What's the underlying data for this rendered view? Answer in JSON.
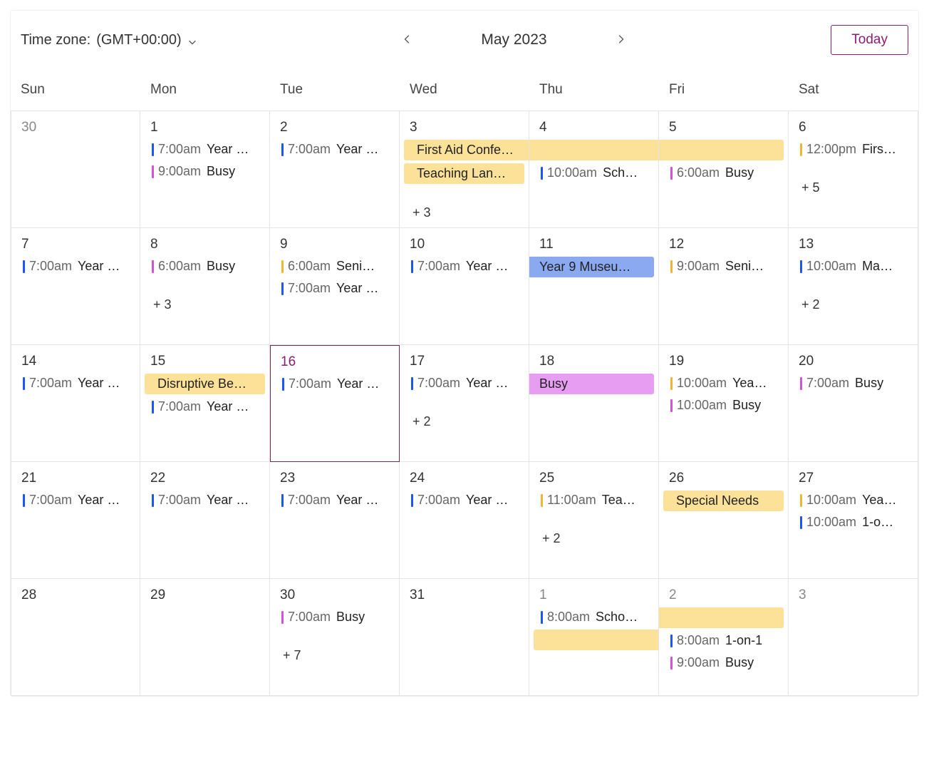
{
  "header": {
    "timezone_label": "Time zone:",
    "timezone_value": "(GMT+00:00)",
    "title": "May 2023",
    "today_label": "Today"
  },
  "weekdays": [
    "Sun",
    "Mon",
    "Tue",
    "Wed",
    "Thu",
    "Fri",
    "Sat"
  ],
  "weeks": [
    [
      {
        "day": "30",
        "other": true,
        "events": []
      },
      {
        "day": "1",
        "events": [
          {
            "type": "bar",
            "color": "blue",
            "time": "7:00am",
            "label": "Year …"
          },
          {
            "type": "bar",
            "color": "pink",
            "time": "9:00am",
            "label": "Busy"
          }
        ]
      },
      {
        "day": "2",
        "events": [
          {
            "type": "bar",
            "color": "blue",
            "time": "7:00am",
            "label": "Year …"
          }
        ]
      },
      {
        "day": "3",
        "events": [
          {
            "type": "fill",
            "fill": "yellow",
            "round": "left",
            "label": "First Aid Confe…"
          },
          {
            "type": "fill",
            "fill": "yellow",
            "round": "both",
            "label": "Teaching Lan…"
          }
        ],
        "more": "+ 3"
      },
      {
        "day": "4",
        "events": [
          {
            "type": "fill",
            "fill": "yellow",
            "label": ""
          },
          {
            "type": "bar",
            "color": "blue",
            "time": "10:00am",
            "label": "Sch…"
          }
        ]
      },
      {
        "day": "5",
        "events": [
          {
            "type": "fill",
            "fill": "yellow",
            "round": "right",
            "label": ""
          },
          {
            "type": "bar",
            "color": "pink",
            "time": "6:00am",
            "label": "Busy"
          }
        ]
      },
      {
        "day": "6",
        "events": [
          {
            "type": "bar",
            "color": "orange",
            "time": "12:00pm",
            "label": "Firs…"
          }
        ],
        "more": "+ 5"
      }
    ],
    [
      {
        "day": "7",
        "events": [
          {
            "type": "bar",
            "color": "blue",
            "time": "7:00am",
            "label": "Year …"
          }
        ]
      },
      {
        "day": "8",
        "events": [
          {
            "type": "bar",
            "color": "pink",
            "time": "6:00am",
            "label": "Busy"
          }
        ],
        "more": "+ 3"
      },
      {
        "day": "9",
        "events": [
          {
            "type": "bar",
            "color": "orange",
            "time": "6:00am",
            "label": "Seni…"
          },
          {
            "type": "bar",
            "color": "blue",
            "time": "7:00am",
            "label": "Year …"
          }
        ]
      },
      {
        "day": "10",
        "events": [
          {
            "type": "bar",
            "color": "blue",
            "time": "7:00am",
            "label": "Year …"
          }
        ]
      },
      {
        "day": "11",
        "events": [
          {
            "type": "fill",
            "fill": "blue",
            "label": "Year 9 Museu…"
          }
        ]
      },
      {
        "day": "12",
        "events": [
          {
            "type": "bar",
            "color": "orange",
            "time": "9:00am",
            "label": "Seni…"
          }
        ]
      },
      {
        "day": "13",
        "events": [
          {
            "type": "bar",
            "color": "blue",
            "time": "10:00am",
            "label": "Ma…"
          }
        ],
        "more": "+ 2"
      }
    ],
    [
      {
        "day": "14",
        "events": [
          {
            "type": "bar",
            "color": "blue",
            "time": "7:00am",
            "label": "Year …"
          }
        ]
      },
      {
        "day": "15",
        "events": [
          {
            "type": "fill",
            "fill": "yellow",
            "round": "both",
            "label": "Disruptive Be…"
          },
          {
            "type": "bar",
            "color": "blue",
            "time": "7:00am",
            "label": "Year …"
          }
        ]
      },
      {
        "day": "16",
        "today": true,
        "events": [
          {
            "type": "bar",
            "color": "blue",
            "time": "7:00am",
            "label": "Year …"
          }
        ]
      },
      {
        "day": "17",
        "events": [
          {
            "type": "bar",
            "color": "blue",
            "time": "7:00am",
            "label": "Year …"
          }
        ],
        "more": "+ 2"
      },
      {
        "day": "18",
        "events": [
          {
            "type": "fill",
            "fill": "purple",
            "label": "Busy"
          }
        ]
      },
      {
        "day": "19",
        "events": [
          {
            "type": "bar",
            "color": "orange",
            "time": "10:00am",
            "label": "Yea…"
          },
          {
            "type": "bar",
            "color": "pink",
            "time": "10:00am",
            "label": "Busy"
          }
        ]
      },
      {
        "day": "20",
        "events": [
          {
            "type": "bar",
            "color": "pink",
            "time": "7:00am",
            "label": "Busy"
          }
        ]
      }
    ],
    [
      {
        "day": "21",
        "events": [
          {
            "type": "bar",
            "color": "blue",
            "time": "7:00am",
            "label": "Year …"
          }
        ]
      },
      {
        "day": "22",
        "events": [
          {
            "type": "bar",
            "color": "blue",
            "time": "7:00am",
            "label": "Year …"
          }
        ]
      },
      {
        "day": "23",
        "events": [
          {
            "type": "bar",
            "color": "blue",
            "time": "7:00am",
            "label": "Year …"
          }
        ]
      },
      {
        "day": "24",
        "events": [
          {
            "type": "bar",
            "color": "blue",
            "time": "7:00am",
            "label": "Year …"
          }
        ]
      },
      {
        "day": "25",
        "events": [
          {
            "type": "bar",
            "color": "orange",
            "time": "11:00am",
            "label": "Tea…"
          }
        ],
        "more": "+ 2"
      },
      {
        "day": "26",
        "events": [
          {
            "type": "fill",
            "fill": "yellow",
            "round": "both",
            "label": "Special Needs"
          }
        ]
      },
      {
        "day": "27",
        "events": [
          {
            "type": "bar",
            "color": "orange",
            "time": "10:00am",
            "label": "Yea…"
          },
          {
            "type": "bar",
            "color": "blue",
            "time": "10:00am",
            "label": "1-o…"
          }
        ]
      }
    ],
    [
      {
        "day": "28",
        "events": []
      },
      {
        "day": "29",
        "events": []
      },
      {
        "day": "30",
        "events": [
          {
            "type": "bar",
            "color": "pink",
            "time": "7:00am",
            "label": "Busy"
          }
        ],
        "more": "+ 7"
      },
      {
        "day": "31",
        "events": []
      },
      {
        "day": "1",
        "other": true,
        "events": [
          {
            "type": "bar",
            "color": "blue",
            "time": "8:00am",
            "label": "Scho…"
          },
          {
            "type": "fill",
            "fill": "yellow",
            "round": "left",
            "label": ""
          }
        ]
      },
      {
        "day": "2",
        "other": true,
        "events": [
          {
            "type": "fill",
            "fill": "yellow",
            "round": "right",
            "label": ""
          },
          {
            "type": "bar",
            "color": "blue",
            "time": "8:00am",
            "label": "1-on-1"
          },
          {
            "type": "bar",
            "color": "pink",
            "time": "9:00am",
            "label": "Busy"
          }
        ]
      },
      {
        "day": "3",
        "other": true,
        "events": []
      }
    ]
  ]
}
